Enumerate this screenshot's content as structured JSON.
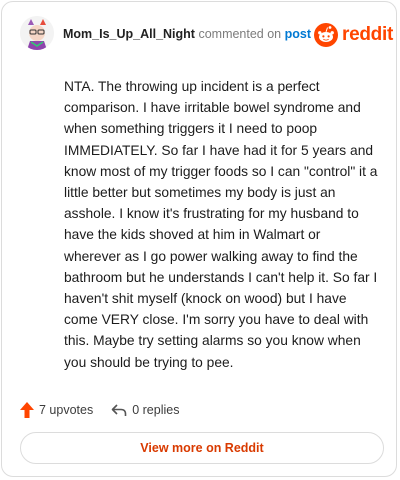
{
  "header": {
    "username": "Mom_Is_Up_All_Night",
    "commented_on": "commented on",
    "post_link": "post",
    "brand": "reddit"
  },
  "comment": {
    "text": "NTA. The throwing up incident is a perfect comparison. I have irritable bowel syndrome and when something triggers it I need to poop IMMEDIATELY. So far I have had it for 5 years and know most of my trigger foods so I can \"control\" it a little better but sometimes my body is just an asshole. I know it's frustrating for my husband to have the kids shoved at him in Walmart or wherever as I go power walking away to find the bathroom but he understands I can't help it. So far I haven't shit myself (knock on wood) but I have come VERY close. I'm sorry you have to deal with this. Maybe try setting alarms so you know when you should be trying to pee."
  },
  "actions": {
    "upvotes": "7 upvotes",
    "replies": "0 replies"
  },
  "footer": {
    "view_more": "View more on Reddit"
  },
  "colors": {
    "brand": "#ff4500",
    "link": "#0079d3",
    "view_more": "#d93a00"
  },
  "icons": [
    "avatar-image",
    "reddit-logo-icon",
    "upvote-arrow-icon",
    "reply-icon"
  ]
}
